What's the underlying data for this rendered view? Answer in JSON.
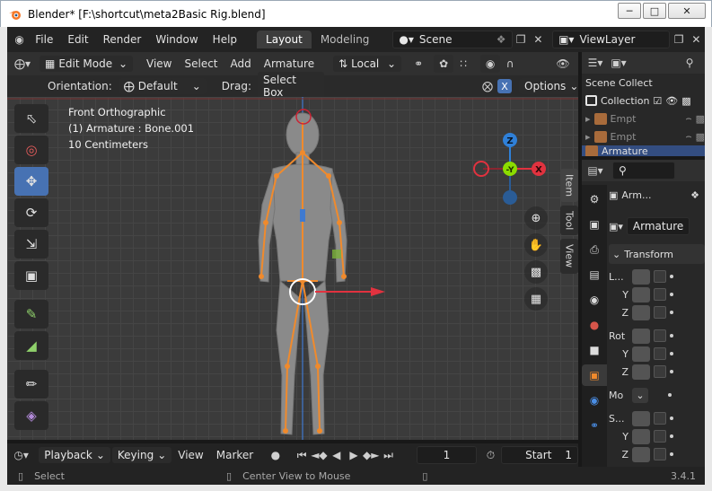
{
  "window": {
    "title": "Blender* [F:\\shortcut\\meta2Basic Rig.blend]",
    "controls": [
      "minimize",
      "maximize",
      "close"
    ]
  },
  "topbar": {
    "menus": [
      "File",
      "Edit",
      "Render",
      "Window",
      "Help"
    ],
    "workspace_tabs": [
      "Layout",
      "Modeling"
    ],
    "active_tab": "Layout",
    "scene": "Scene",
    "view_layer": "ViewLayer"
  },
  "viewport_header": {
    "mode": "Edit Mode",
    "menus": [
      "View",
      "Select",
      "Add",
      "Armature"
    ],
    "transform_orientation": "Local"
  },
  "tool_settings": {
    "orientation_label": "Orientation:",
    "orientation_value": "Default",
    "drag_label": "Drag:",
    "drag_value": "Select Box",
    "x_mirror": "X",
    "options_label": "Options"
  },
  "viewport": {
    "view_name": "Front Orthographic",
    "object_info": "(1) Armature : Bone.001",
    "scale_info": "10 Centimeters",
    "gizmo_axes": {
      "z": "Z",
      "y": "-Y",
      "x": "X"
    },
    "sidebar_tabs": [
      "Item",
      "Tool",
      "View"
    ]
  },
  "toolbar": {
    "tools": [
      "select-box",
      "cursor",
      "move",
      "rotate",
      "scale",
      "transform",
      "annotate",
      "measure",
      "extrude",
      "shear"
    ]
  },
  "outliner": {
    "title": "Scene Collect",
    "rows": [
      {
        "label": "Collection"
      },
      {
        "label": "Empt"
      },
      {
        "label": "Empt"
      },
      {
        "label": "Armature"
      }
    ]
  },
  "properties": {
    "object_name": "Arm...",
    "data_name": "Armature",
    "panel": "Transform",
    "location_label": "L...",
    "rotation_label": "Rot",
    "mode_label": "Mo",
    "scale_label": "S...",
    "axis_y": "Y",
    "axis_z": "Z"
  },
  "timeline": {
    "menus": [
      "Playback",
      "Keying",
      "View",
      "Marker"
    ],
    "current_frame": "1",
    "start_label": "Start",
    "start_value": "1"
  },
  "statusbar": {
    "left_action": "Select",
    "middle_action": "Center View to Mouse",
    "version": "3.4.1"
  },
  "colors": {
    "accent": "#4772b3",
    "bone": "#f08a2c",
    "axis_x": "#e1323f",
    "axis_y": "#8bdc00",
    "axis_z": "#2f80d8"
  }
}
